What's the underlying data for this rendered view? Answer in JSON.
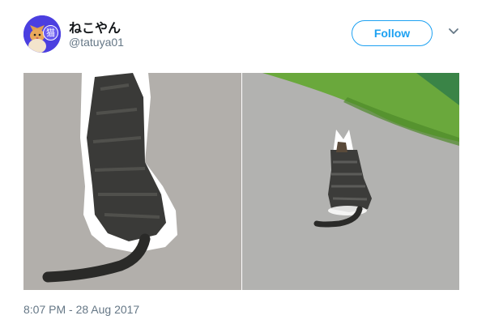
{
  "user": {
    "display_name": "ねこやん",
    "handle": "@tatuya01",
    "avatar_badge": "猫"
  },
  "actions": {
    "follow_label": "Follow"
  },
  "icons": {
    "menu": "chevron-down-icon"
  },
  "media": {
    "photo_count": 2
  },
  "tweet": {
    "timestamp": "8:07 PM - 28 Aug 2017"
  },
  "colors": {
    "accent": "#1da1f2",
    "secondary_text": "#657786",
    "primary_text": "#14171a"
  }
}
